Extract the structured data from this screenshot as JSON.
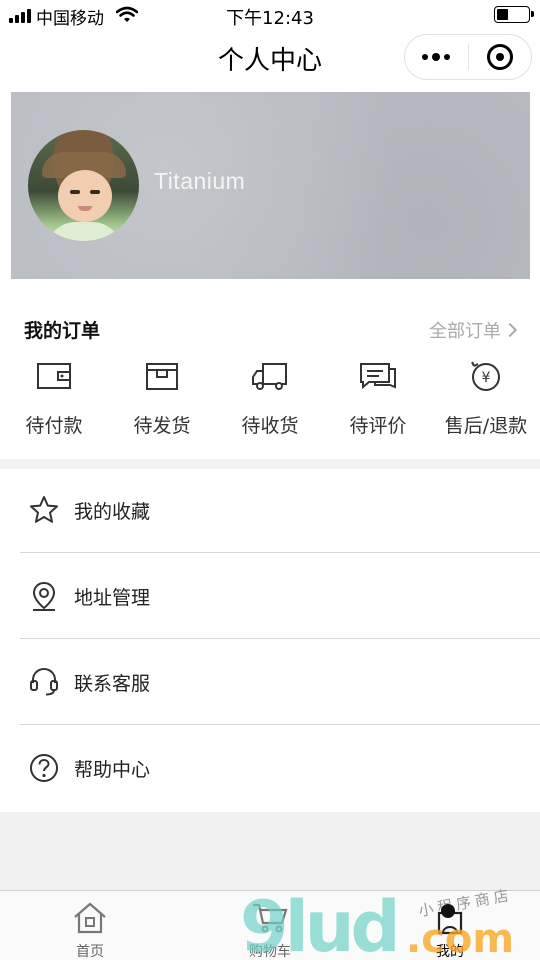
{
  "status_bar": {
    "carrier": "中国移动",
    "time": "下午12:43",
    "battery_level": 0.35,
    "signal_bars": 4
  },
  "nav": {
    "title": "个人中心"
  },
  "profile": {
    "username": "Titanium"
  },
  "orders": {
    "title": "我的订单",
    "all_label": "全部订单",
    "items": [
      {
        "label": "待付款",
        "icon": "wallet-icon"
      },
      {
        "label": "待发货",
        "icon": "package-icon"
      },
      {
        "label": "待收货",
        "icon": "truck-icon"
      },
      {
        "label": "待评价",
        "icon": "comment-icon"
      },
      {
        "label": "售后/退款",
        "icon": "refund-icon"
      }
    ]
  },
  "menu": {
    "items": [
      {
        "label": "我的收藏",
        "icon": "star-icon"
      },
      {
        "label": "地址管理",
        "icon": "location-icon"
      },
      {
        "label": "联系客服",
        "icon": "headset-icon"
      },
      {
        "label": "帮助中心",
        "icon": "help-icon"
      }
    ]
  },
  "tabbar": {
    "tabs": [
      {
        "label": "首页",
        "icon": "home-icon"
      },
      {
        "label": "购物车",
        "icon": "cart-icon"
      },
      {
        "label": "我的",
        "icon": "user-icon",
        "active": true
      }
    ]
  },
  "watermark": {
    "main": "9lud",
    "suffix": ".com",
    "script": "小程序商店"
  }
}
